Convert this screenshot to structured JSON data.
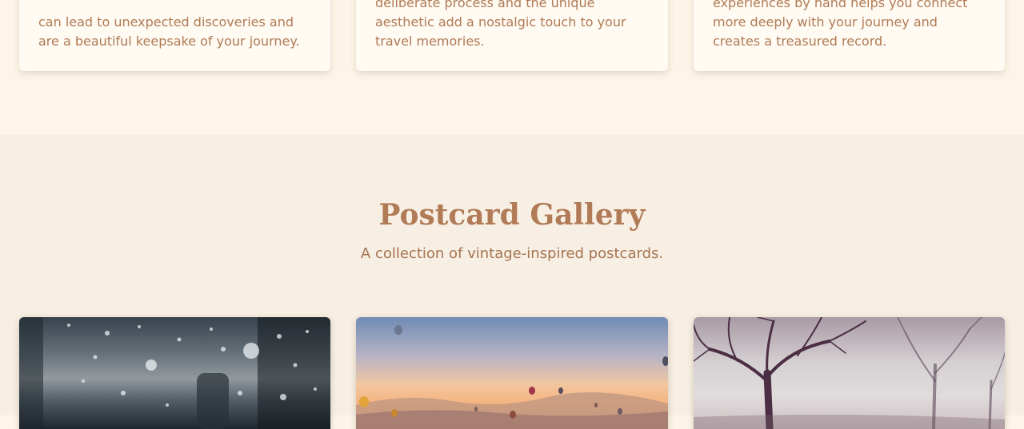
{
  "features": [
    {
      "text": "can lead to unexpected discoveries and are a beautiful keepsake of your journey."
    },
    {
      "text": "deliberate process and the unique aesthetic add a nostalgic touch to your travel memories."
    },
    {
      "text": "experiences by hand helps you connect more deeply with your journey and creates a treasured record."
    }
  ],
  "gallery": {
    "title": "Postcard Gallery",
    "subtitle": "A collection of vintage-inspired postcards.",
    "postcards": [
      {
        "image": "rain-on-window-photo"
      },
      {
        "image": "hot-air-balloons-photo"
      },
      {
        "image": "misty-trees-photo"
      }
    ]
  },
  "colors": {
    "page_background": "#fcf5e8",
    "gallery_background": "#f7efe3",
    "accent_text": "#b17b57"
  }
}
